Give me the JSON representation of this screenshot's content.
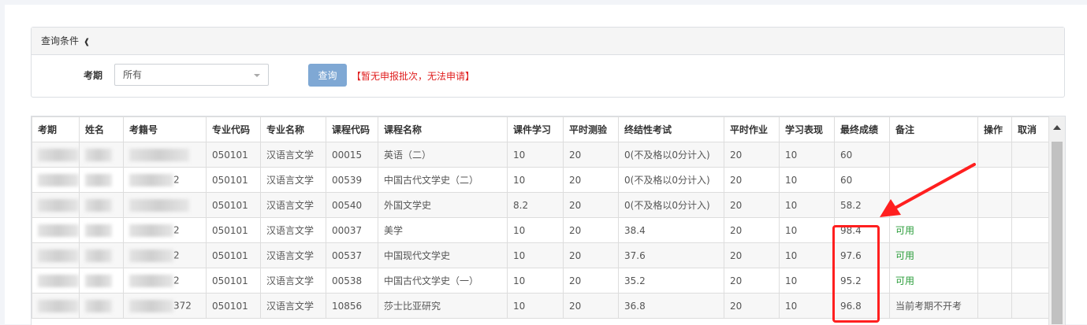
{
  "query_panel": {
    "heading": "查询条件",
    "term_label": "考期",
    "term_value": "所有",
    "query_button": "查询",
    "notice": "【暂无申报批次，无法申请】"
  },
  "table": {
    "headers": [
      "考期",
      "姓名",
      "考籍号",
      "专业代码",
      "专业名称",
      "课程代码",
      "课程名称",
      "课件学习",
      "平时测验",
      "终结性考试",
      "平时作业",
      "学习表现",
      "最终成绩",
      "备注",
      "操作",
      "取消"
    ],
    "rows": [
      {
        "term": "",
        "name": "",
        "exam_id": "",
        "major_code": "050101",
        "major_name": "汉语言文学",
        "course_code": "00015",
        "course_name": "英语（二）",
        "courseware": "10",
        "quiz": "20",
        "final_exam": "0(不及格以0分计入)",
        "homework": "20",
        "performance": "10",
        "final_score": "60",
        "note": "",
        "action": "",
        "cancel": ""
      },
      {
        "term": "",
        "name": "",
        "exam_id": "2",
        "major_code": "050101",
        "major_name": "汉语言文学",
        "course_code": "00539",
        "course_name": "中国古代文学史（二）",
        "courseware": "10",
        "quiz": "20",
        "final_exam": "0(不及格以0分计入)",
        "homework": "20",
        "performance": "10",
        "final_score": "60",
        "note": "",
        "action": "",
        "cancel": ""
      },
      {
        "term": "",
        "name": "",
        "exam_id": "",
        "major_code": "050101",
        "major_name": "汉语言文学",
        "course_code": "00540",
        "course_name": "外国文学史",
        "courseware": "8.2",
        "quiz": "20",
        "final_exam": "0(不及格以0分计入)",
        "homework": "20",
        "performance": "10",
        "final_score": "58.2",
        "note": "",
        "action": "",
        "cancel": ""
      },
      {
        "term": "",
        "name": "",
        "exam_id": "2",
        "major_code": "050101",
        "major_name": "汉语言文学",
        "course_code": "00037",
        "course_name": "美学",
        "courseware": "10",
        "quiz": "20",
        "final_exam": "38.4",
        "homework": "20",
        "performance": "10",
        "final_score": "98.4",
        "note": "可用",
        "action": "",
        "cancel": ""
      },
      {
        "term": "",
        "name": "",
        "exam_id": "2",
        "major_code": "050101",
        "major_name": "汉语言文学",
        "course_code": "00537",
        "course_name": "中国现代文学史",
        "courseware": "10",
        "quiz": "20",
        "final_exam": "37.6",
        "homework": "20",
        "performance": "10",
        "final_score": "97.6",
        "note": "可用",
        "action": "",
        "cancel": ""
      },
      {
        "term": "",
        "name": "",
        "exam_id": "2",
        "major_code": "050101",
        "major_name": "汉语言文学",
        "course_code": "00538",
        "course_name": "中国古代文学史（一）",
        "courseware": "10",
        "quiz": "20",
        "final_exam": "35.2",
        "homework": "20",
        "performance": "10",
        "final_score": "95.2",
        "note": "可用",
        "action": "",
        "cancel": ""
      },
      {
        "term": "",
        "name": "",
        "exam_id": "372",
        "major_code": "050101",
        "major_name": "汉语言文学",
        "course_code": "10856",
        "course_name": "莎士比亚研究",
        "courseware": "10",
        "quiz": "20",
        "final_exam": "36.8",
        "homework": "20",
        "performance": "10",
        "final_score": "96.8",
        "note": "当前考期不开考",
        "action": "",
        "cancel": ""
      }
    ]
  },
  "colors": {
    "primary_button": "#7fa8d4",
    "notice_red": "#e02020",
    "available_green": "#2a9d3a",
    "annotation_red": "#ff1f1f"
  },
  "icons": {
    "heading_icon": "chevron-down-icon",
    "select_icon": "caret-down-icon",
    "scroll_icon": "scroll-up-arrow-icon"
  }
}
